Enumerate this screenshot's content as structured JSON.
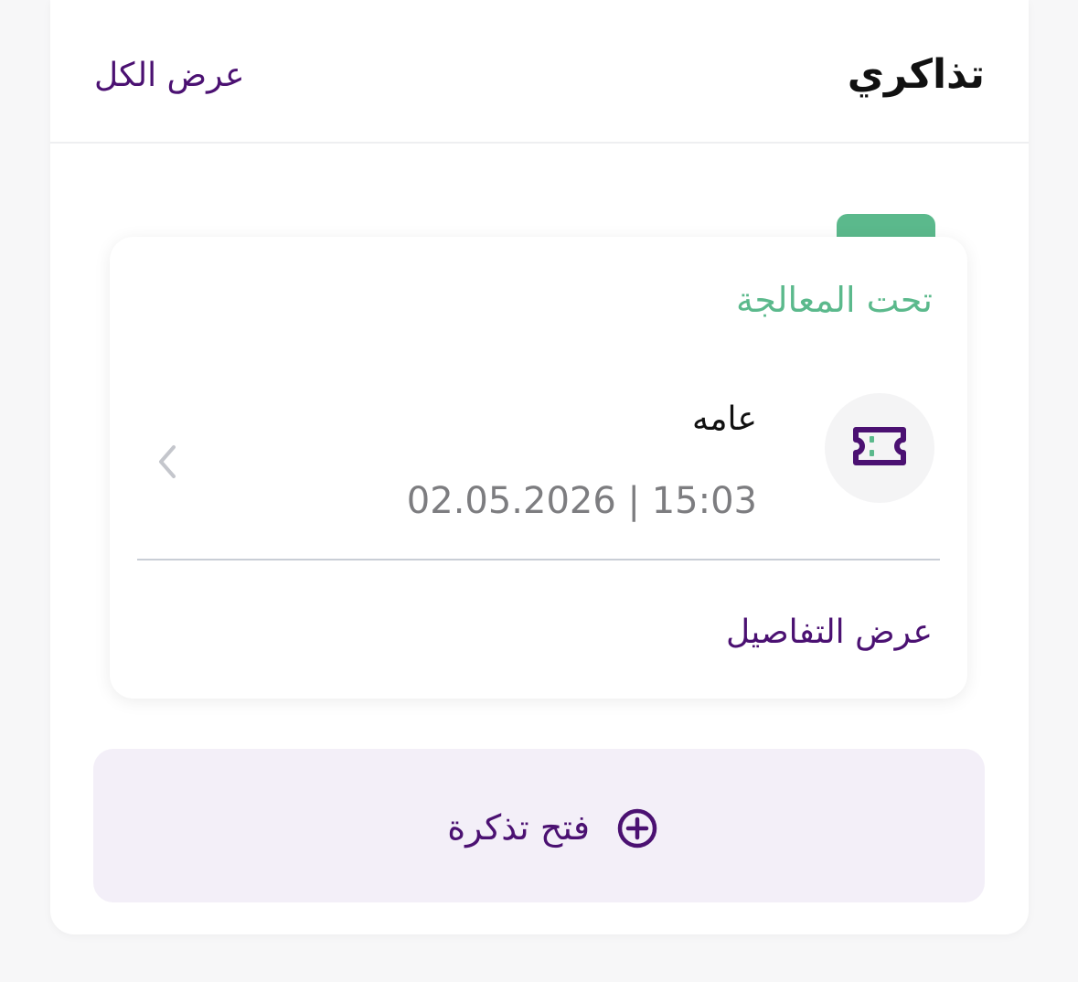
{
  "header": {
    "title": "تذاكري",
    "view_all_label": "عرض الكل"
  },
  "ticket": {
    "status": "تحت المعالجة",
    "category": "عامه",
    "datetime": "02.05.2026 | 15:03",
    "view_details_label": "عرض التفاصيل",
    "icon": "ticket-icon",
    "status_color": "#5bb98c"
  },
  "actions": {
    "open_ticket_label": "فتح تذكرة",
    "open_ticket_icon": "plus-circle-icon"
  },
  "colors": {
    "brand_purple": "#4b1172",
    "status_green": "#5bb98c",
    "button_bg": "#f3eff8"
  }
}
